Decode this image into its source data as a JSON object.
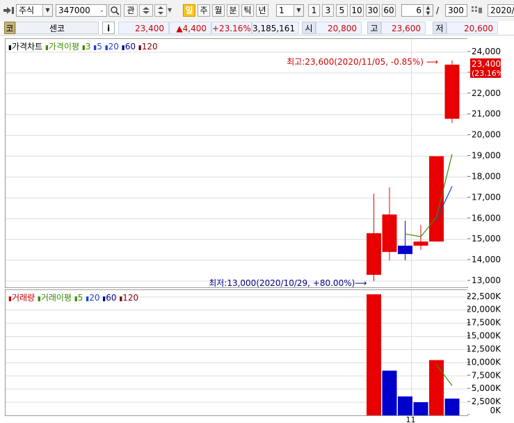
{
  "toolbar": {
    "market": "주식",
    "code": "347000",
    "btn_gwan": "관",
    "periods": [
      "일",
      "주",
      "월",
      "분",
      "틱",
      "년"
    ],
    "active_period": "일",
    "interval": "1",
    "quick_intervals": [
      "1",
      "3",
      "5",
      "10",
      "30",
      "60"
    ],
    "count": "6",
    "total": "300",
    "date": "2020/"
  },
  "quote": {
    "code_btn": "코",
    "name": "센코",
    "info_btn": "i",
    "price": "23,400",
    "change": "▲4,400",
    "change_pct": "+23.16%",
    "volume": "3,185,161",
    "open_label": "시",
    "open": "20,800",
    "high_label": "고",
    "high": "23,600",
    "low_label": "저",
    "low": "20,600"
  },
  "price_legend": [
    {
      "text": "가격차트",
      "color": "#000000"
    },
    {
      "text": "가격이평",
      "color": "#3a8c00"
    },
    {
      "text": "3",
      "color": "#3a8c00"
    },
    {
      "text": "5",
      "color": "#1a3fd6"
    },
    {
      "text": "20",
      "color": "#1a3fd6"
    },
    {
      "text": "60",
      "color": "#000088"
    },
    {
      "text": "120",
      "color": "#800000"
    }
  ],
  "volume_legend": [
    {
      "text": "거래량",
      "color": "#cc0000"
    },
    {
      "text": "거래이평",
      "color": "#3a8c00"
    },
    {
      "text": "5",
      "color": "#3a8c00"
    },
    {
      "text": "20",
      "color": "#1a3fd6"
    },
    {
      "text": "60",
      "color": "#000088"
    },
    {
      "text": "120",
      "color": "#800000"
    }
  ],
  "annotations": {
    "high": "최고:23,600(2020/11/05, -0.85%)",
    "low": "최저:13,000(2020/10/29, +80.00%)",
    "current_price": "23,400",
    "current_pct": "(23.16%)",
    "x_tick": "11"
  },
  "chart_data": [
    {
      "type": "candlestick",
      "title": "가격차트",
      "x": [
        "2020/10/29",
        "2020/10/30",
        "2020/11/02",
        "2020/11/03",
        "2020/11/04",
        "2020/11/05"
      ],
      "open": [
        13300,
        14400,
        14700,
        14700,
        14900,
        20800
      ],
      "high": [
        17200,
        17500,
        15900,
        15700,
        19000,
        23600
      ],
      "low": [
        13000,
        14000,
        14000,
        14500,
        14900,
        20600
      ],
      "close": [
        15300,
        16200,
        14300,
        14900,
        19000,
        23400
      ],
      "up_color": "#e80000",
      "down_color": "#0000cc",
      "ma3": [
        null,
        null,
        15267,
        15133,
        16067,
        19100
      ],
      "ma5": [
        null,
        null,
        null,
        null,
        15940,
        17560
      ],
      "y_ticks": [
        13000,
        14000,
        15000,
        16000,
        17000,
        18000,
        19000,
        20000,
        21000,
        22000,
        23000,
        24000
      ],
      "ylim": [
        12700,
        24400
      ]
    },
    {
      "type": "bar",
      "title": "거래량",
      "x": [
        "2020/10/29",
        "2020/10/30",
        "2020/11/02",
        "2020/11/03",
        "2020/11/04",
        "2020/11/05"
      ],
      "values": [
        23000000,
        8500000,
        3600000,
        2500000,
        10500000,
        3185161
      ],
      "colors": [
        "#e80000",
        "#0000cc",
        "#0000cc",
        "#0000cc",
        "#e80000",
        "#0000cc"
      ],
      "ma5": [
        null,
        null,
        null,
        null,
        9620000,
        5657000
      ],
      "y_ticks": [
        "0K",
        "2,500K",
        "5,000K",
        "7,500K",
        "10,000K",
        "12,500K",
        "15,000K",
        "17,500K",
        "20,000K",
        "22,500K"
      ],
      "y_tick_values": [
        0,
        2500000,
        5000000,
        7500000,
        10000000,
        12500000,
        15000000,
        17500000,
        20000000,
        22500000
      ],
      "ylim": [
        0,
        23800000
      ]
    }
  ]
}
